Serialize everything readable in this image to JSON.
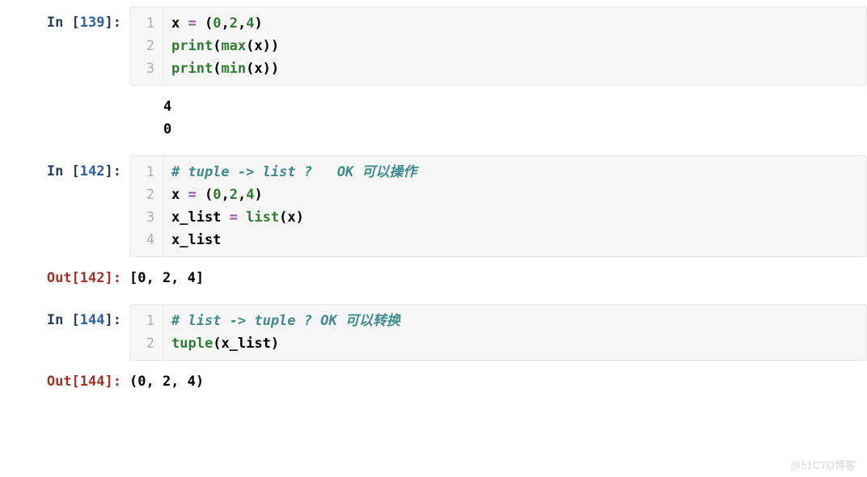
{
  "cells": [
    {
      "type": "code",
      "exec_count": 139,
      "in_label_prefix": "In [",
      "in_label_suffix": "]:",
      "line_numbers": [
        "1",
        "2",
        "3"
      ],
      "code_tokens": [
        [
          [
            "name",
            "x"
          ],
          [
            "plain",
            " "
          ],
          [
            "op",
            "="
          ],
          [
            "plain",
            " "
          ],
          [
            "punc",
            "("
          ],
          [
            "num",
            "0"
          ],
          [
            "punc",
            ","
          ],
          [
            "num",
            "2"
          ],
          [
            "punc",
            ","
          ],
          [
            "num",
            "4"
          ],
          [
            "punc",
            ")"
          ]
        ],
        [
          [
            "builtin",
            "print"
          ],
          [
            "punc",
            "("
          ],
          [
            "builtin",
            "max"
          ],
          [
            "punc",
            "("
          ],
          [
            "name",
            "x"
          ],
          [
            "punc",
            "))"
          ]
        ],
        [
          [
            "builtin",
            "print"
          ],
          [
            "punc",
            "("
          ],
          [
            "builtin",
            "min"
          ],
          [
            "punc",
            "("
          ],
          [
            "name",
            "x"
          ],
          [
            "punc",
            "))"
          ]
        ]
      ],
      "stdout": "4\n0"
    },
    {
      "type": "code",
      "exec_count": 142,
      "in_label_prefix": "In [",
      "in_label_suffix": "]:",
      "out_label_prefix": "Out[",
      "out_label_suffix": "]:",
      "line_numbers": [
        "1",
        "2",
        "3",
        "4"
      ],
      "code_tokens": [
        [
          [
            "comment",
            "# tuple -> list ?   OK 可以操作"
          ]
        ],
        [
          [
            "name",
            "x"
          ],
          [
            "plain",
            " "
          ],
          [
            "op",
            "="
          ],
          [
            "plain",
            " "
          ],
          [
            "punc",
            "("
          ],
          [
            "num",
            "0"
          ],
          [
            "punc",
            ","
          ],
          [
            "num",
            "2"
          ],
          [
            "punc",
            ","
          ],
          [
            "num",
            "4"
          ],
          [
            "punc",
            ")"
          ]
        ],
        [
          [
            "name",
            "x_list"
          ],
          [
            "plain",
            " "
          ],
          [
            "op",
            "="
          ],
          [
            "plain",
            " "
          ],
          [
            "builtin",
            "list"
          ],
          [
            "punc",
            "("
          ],
          [
            "name",
            "x"
          ],
          [
            "punc",
            ")"
          ]
        ],
        [
          [
            "name",
            "x_list"
          ]
        ]
      ],
      "result": "[0, 2, 4]"
    },
    {
      "type": "code",
      "exec_count": 144,
      "in_label_prefix": "In [",
      "in_label_suffix": "]:",
      "out_label_prefix": "Out[",
      "out_label_suffix": "]:",
      "line_numbers": [
        "1",
        "2"
      ],
      "code_tokens": [
        [
          [
            "comment",
            "# list -> tuple ? OK 可以转换"
          ]
        ],
        [
          [
            "builtin",
            "tuple"
          ],
          [
            "punc",
            "("
          ],
          [
            "name",
            "x_list"
          ],
          [
            "punc",
            ")"
          ]
        ]
      ],
      "result": "(0, 2, 4)"
    }
  ],
  "watermark": "@51CTO博客"
}
